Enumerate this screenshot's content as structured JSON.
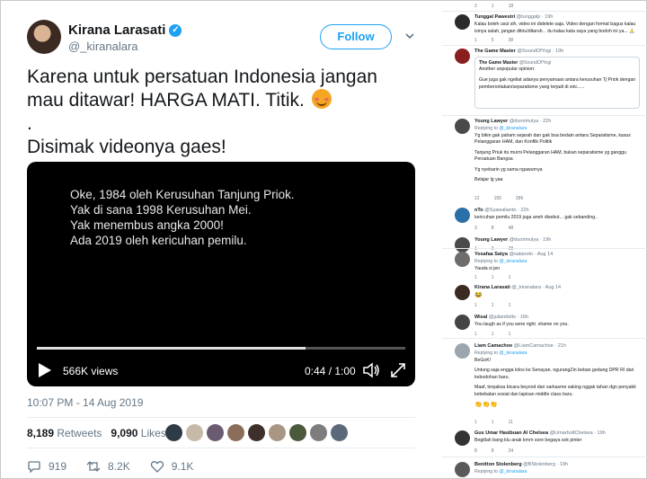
{
  "tweet": {
    "author_name": "Kirana Larasati",
    "author_handle": "@_kiranalara",
    "follow_label": "Follow",
    "text_lines": [
      "Karena untuk persatuan Indonesia jangan",
      "mau ditawar! HARGA MATI. Titik.",
      ".",
      "Disimak videonya gaes!"
    ],
    "video": {
      "lines": [
        "Oke, 1984 oleh Kerusuhan Tanjung Priok.",
        "Yak di sana 1998 Kerusuhan Mei.",
        "Yak menembus angka 2000!",
        "Ada 2019 oleh kericuhan pemilu."
      ],
      "views": "566K views",
      "time": "0:44 / 1:00",
      "progress": 0.73
    },
    "timestamp": "10:07 PM - 14 Aug 2019",
    "retweets_count": "8,189",
    "retweets_label": "Retweets",
    "likes_count": "9,090",
    "likes_label": "Likes",
    "reply_count": "919",
    "retweet_action_count": "8.2K",
    "like_action_count": "9.1K",
    "colors": {
      "accent": "#1da1f2",
      "muted": "#657786"
    }
  },
  "replies": [
    {
      "counts": [
        "2",
        "1",
        "18"
      ]
    },
    {
      "name": "Tunggal Pawestri",
      "handle": "@tunggalp · 19h",
      "lines": [
        "Kalau boleh usul sih, video ini didelete saja. Video dengan format bagus kalau",
        "isinya salah, jangan ditiru/ditaruh... itu kalau kata saya yang bodoh ini ya... 🙏"
      ],
      "counts": [
        "1",
        "5",
        "38"
      ]
    },
    {
      "name": "The Game Master",
      "handle": "@SoundOfYogi · 19h",
      "quote_name": "The Game Master",
      "quote_handle": "@SoundOfYogi",
      "quote_lines": [
        "Another unpopular opinion:",
        "Gue juga gak ngeliat adanya penyamaan antara kerusuhan Tj Priok dengan",
        "pemberontakan/separatisme yang terjadi di sini......"
      ]
    },
    {
      "name": "Young Lawyer",
      "handle": "@duorimulya · 22h",
      "reply_to": "@_kiranalara",
      "lines": [
        "Yg bikin gak paham sejarah dan gak bsa bedain antara Separatisme, kasus",
        "Pelanggaran HAM, dan Konflik Politik",
        "",
        "Tanjung Priuk itu murni Pelanggaran HAM, bukan separatisme yg ganggu",
        "Persatuan Bangsa",
        "",
        "Yg nyebarin yg sama ngawurnya",
        "",
        "Belajar lg yaa"
      ],
      "counts": [
        "12",
        "155",
        "396"
      ]
    },
    {
      "name": "nTo",
      "handle": "@Syawalianto · 22h",
      "lines": [
        "kericuhan pemilu 2019 juga aneh disebut... gak sebanding.."
      ],
      "counts": [
        "3",
        "8",
        "48"
      ]
    },
    {
      "name": "Young Lawyer",
      "handle": "@duorimulya · 19h",
      "counts": [
        "1",
        "3",
        "28"
      ]
    },
    {
      "name": "Yosafaa Satya",
      "handle": "@satanoto · Aug 14",
      "reply_to": "@_kiranalara",
      "lines": [
        "Yauda si jen"
      ],
      "counts": [
        "1",
        "1",
        "1"
      ]
    },
    {
      "name": "Kirana Larasati",
      "handle": "@_kiranalara · Aug 14",
      "lines": [
        "😂"
      ],
      "counts": [
        "1",
        "1",
        "1"
      ]
    },
    {
      "name": "Wisal",
      "handle": "@julianttollo · 16h",
      "lines": [
        "You laugh as if you were right. shame on you."
      ],
      "counts": [
        "1",
        "1",
        "1"
      ]
    },
    {
      "name": "Liam Camachoe",
      "handle": "@LiamCamachoe · 21h",
      "reply_to": "@_kiranalara",
      "lines": [
        "BeGoK!",
        "",
        "Untung saja engga lolos ke Senayan. ngurangZin beban gedung DPR RI dari",
        "kebodohan baru.",
        "",
        "Maaf, terpaksa bicara beyond dari sarkasme saking nggak tahan dgn penyakit",
        "kebebalan sosial dan lapisan middle class baru.",
        "",
        "👏👏👏"
      ],
      "counts": [
        "1",
        "1",
        "11"
      ]
    },
    {
      "name": "Gus Umar Hasibuan Al Chelsea",
      "handle": "@UmarholtChelsea · 19h",
      "lines": [
        "Begitlah bang klu anak kmrn sore begaya sok pinter"
      ],
      "counts": [
        "8",
        "8",
        "24"
      ]
    },
    {
      "name": "Benitton Stolenberg",
      "handle": "@BStolenberg · 19h",
      "reply_to": "@_kiranalara"
    }
  ]
}
